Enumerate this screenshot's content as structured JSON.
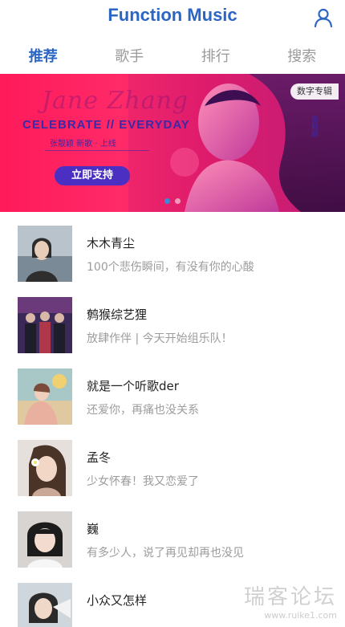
{
  "header": {
    "title": "Function Music",
    "user_icon": "user-icon"
  },
  "tabs": [
    {
      "label": "推荐",
      "active": true
    },
    {
      "label": "歌手",
      "active": false
    },
    {
      "label": "排行",
      "active": false
    },
    {
      "label": "搜索",
      "active": false
    }
  ],
  "banner": {
    "script_text": "Jane Zhang",
    "headline": "CELEBRATE // EVERYDAY",
    "subline": "张靓颖 新歌 · 上线",
    "cta_label": "立即支持",
    "album_tag": "数字专辑",
    "side_mark": "张靓颖",
    "slide_count": 2,
    "active_slide": 1
  },
  "playlists": [
    {
      "title": "木木青尘",
      "desc": "100个悲伤瞬间，有没有你的心酸"
    },
    {
      "title": "鹩猴综艺狸",
      "desc": "放肆作伴 | 今天开始组乐队！"
    },
    {
      "title": "就是一个听歌der",
      "desc": "还爱你，再痛也没关系"
    },
    {
      "title": "孟冬",
      "desc": "少女怀春！我又恋爱了"
    },
    {
      "title": "巍",
      "desc": "有多少人，说了再见却再也没见"
    },
    {
      "title": "小众又怎样",
      "desc": ""
    }
  ],
  "watermark": {
    "main": "瑞客论坛",
    "sub": "www.ruike1.com"
  },
  "colors": {
    "accent": "#2b66c4",
    "banner_pink": "#ff2a68",
    "banner_cta": "#4b2fc2",
    "muted_text": "#9c9c9c"
  }
}
